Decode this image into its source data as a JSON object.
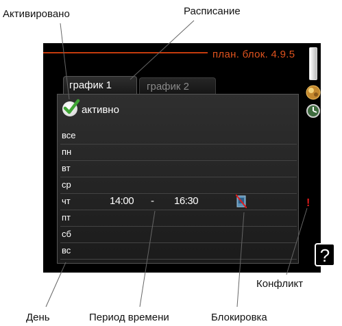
{
  "callouts": {
    "activated": "Активировано",
    "schedule": "Расписание",
    "conflict": "Конфликт",
    "day": "День",
    "time_period": "Период времени",
    "block": "Блокировка"
  },
  "screen": {
    "menu_code": "план. блок. 4.9.5",
    "tabs": [
      {
        "label": "график 1",
        "selected": true
      },
      {
        "label": "график 2",
        "selected": false
      }
    ],
    "active_label": "активно",
    "days": [
      "все",
      "пн",
      "вт",
      "ср",
      "чт",
      "пт",
      "сб",
      "вс"
    ],
    "entry": {
      "day": "чт",
      "start": "14:00",
      "dash": "-",
      "end": "16:30"
    },
    "conflict_mark": "!",
    "help_label": "?"
  },
  "colors": {
    "menu_code": "#e0531e",
    "accent_line": "#c63c0d",
    "check_green": "#3fa535",
    "conflict_red": "#e01b1b"
  },
  "icons": [
    "check-icon",
    "block-icon",
    "thermostat-icon",
    "clock-icon",
    "help-icon"
  ]
}
